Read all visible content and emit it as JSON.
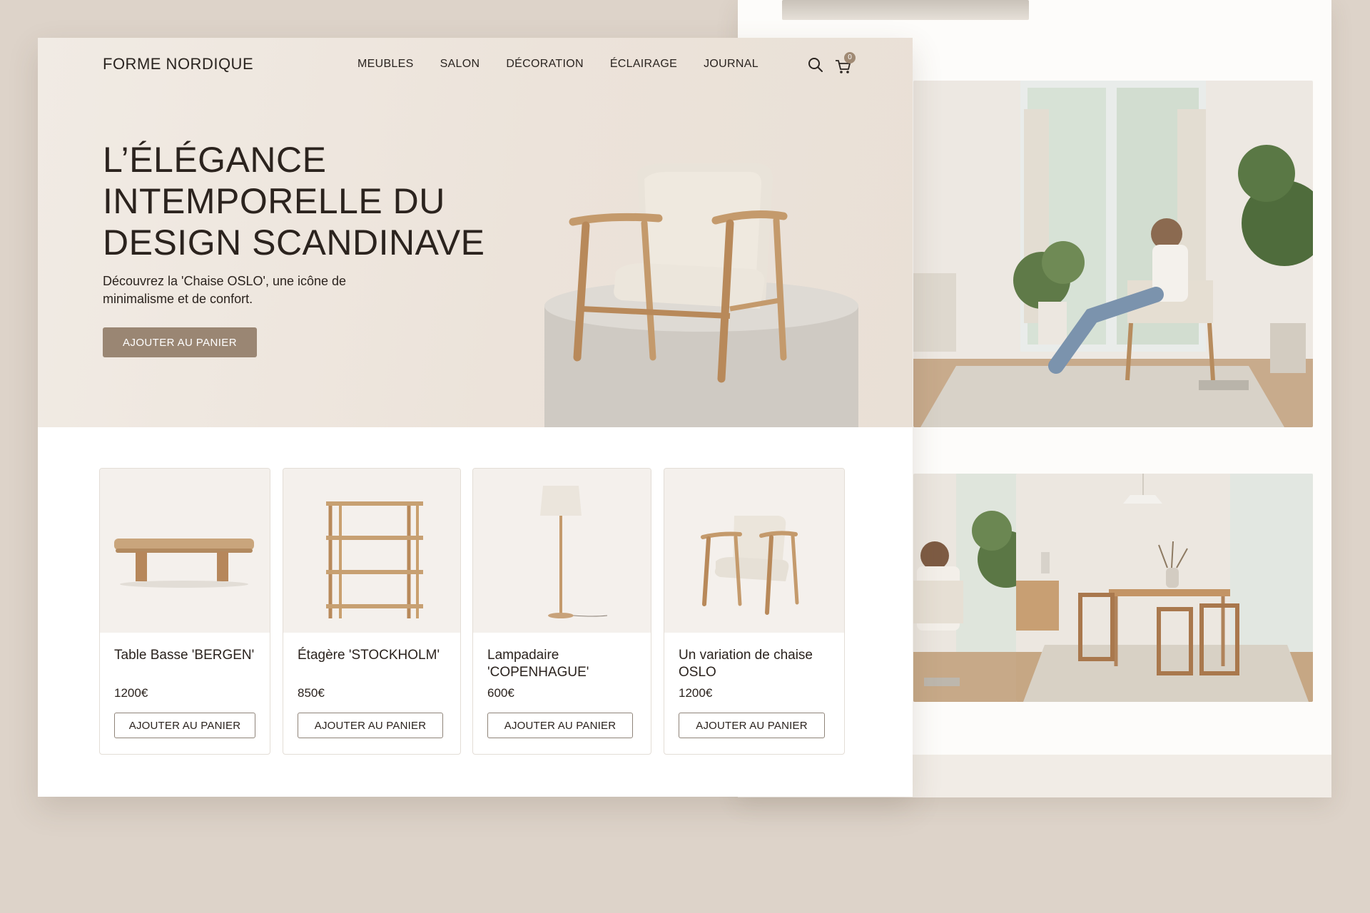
{
  "brand": {
    "name": "FORME NORDIQUE"
  },
  "nav": {
    "items": [
      "MEUBLES",
      "SALON",
      "DÉCORATION",
      "ÉCLAIRAGE",
      "JOURNAL"
    ]
  },
  "header": {
    "search_icon": "search-icon",
    "cart_icon": "shopping-cart-icon",
    "cart_count": "0"
  },
  "hero": {
    "title_lines": [
      "L’ÉLÉGANCE",
      "INTEMPORELLE DU",
      "DESIGN SCANDINAVE"
    ],
    "subtitle": "Découvrez la 'Chaise OSLO', une icône de minimalisme et de confort.",
    "cta_label": "AJOUTER AU PANIER"
  },
  "products": [
    {
      "name": "Table Basse 'BERGEN'",
      "price": "1200€",
      "cta_label": "AJOUTER AU PANIER",
      "image": "coffee-table"
    },
    {
      "name": "Étagère 'STOCKHOLM'",
      "price": "850€",
      "cta_label": "AJOUTER AU PANIER",
      "image": "shelf"
    },
    {
      "name": "Lampadaire 'COPENHAGUE'",
      "price": "600€",
      "cta_label": "AJOUTER AU PANIER",
      "image": "floor-lamp"
    },
    {
      "name": "Un variation de chaise OSLO",
      "price": "1200€",
      "cta_label": "AJOUTER AU PANIER",
      "image": "armchair"
    }
  ],
  "colors": {
    "page_background": "#ddd3c9",
    "hero_background": "#ede5dc",
    "accent_button": "#9a8673",
    "text": "#2b231e",
    "wood": "#c49a6c",
    "fabric": "#ece6dc"
  }
}
